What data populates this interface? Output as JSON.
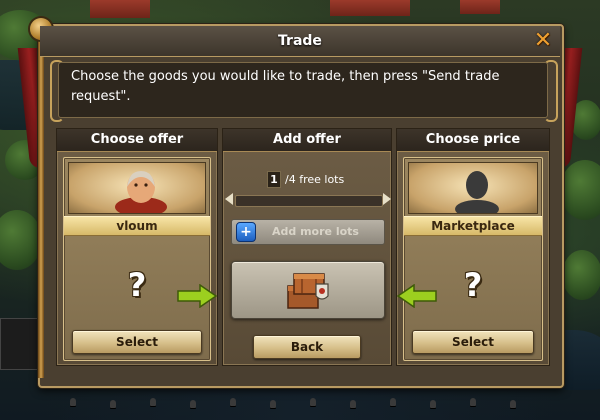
{
  "dialog": {
    "title": "Trade",
    "close_label": "✕",
    "description": "Choose the goods you would like to trade, then press \"Send trade request\"."
  },
  "offer": {
    "header": "Choose offer",
    "player_name": "vloum",
    "placeholder": "?",
    "select_label": "Select"
  },
  "add_offer": {
    "header": "Add offer",
    "lots_count": "1",
    "lots_text": "/4 free lots",
    "slider_fraction": 0.0,
    "add_more_label": "Add more lots",
    "back_label": "Back"
  },
  "price": {
    "header": "Choose price",
    "partner_name": "Marketplace",
    "placeholder": "?",
    "select_label": "Select"
  },
  "colors": {
    "arrow_green": "#9ccf1f",
    "close_orange": "#f0a030",
    "accent_gold": "#d7b968"
  },
  "icons": {
    "close": "close-icon",
    "portrait_player": "player-portrait",
    "portrait_marketplace": "silhouette-icon",
    "crates": "crates-icon",
    "plus": "plus-icon",
    "arrow": "arrow-right-icon"
  }
}
